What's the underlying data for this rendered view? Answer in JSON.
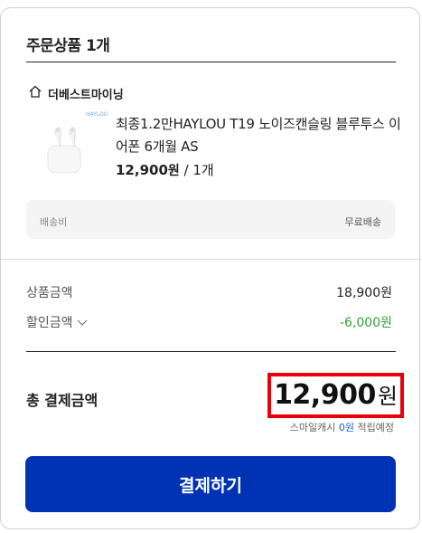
{
  "order": {
    "section_title": "주문상품 1개",
    "seller": {
      "name": "더베스트마이닝",
      "icon": "home-icon"
    },
    "product": {
      "name": "최종1.2만HAYLOU T19 노이즈캔슬링 블루투스 이어폰 6개월 AS",
      "price": "12,900",
      "price_unit": "원",
      "quantity": " / 1개",
      "thumbnail_tag": "HAYLOU",
      "thumbnail": "earbuds-product-image"
    },
    "shipping": {
      "label": "배송비",
      "value": "무료배송"
    }
  },
  "summary": {
    "goods_label": "상품금액",
    "goods_value": "18,900원",
    "discount_label": "할인금액",
    "discount_value": "-6,000원",
    "discount_icon": "chevron-down-icon",
    "total_label": "총 결제금액",
    "total_amount": "12,900",
    "total_unit": "원",
    "reward_prefix": "스마일캐시 ",
    "reward_amount": "0원",
    "reward_suffix": " 적립예정"
  },
  "checkout": {
    "button_label": "결제하기"
  },
  "colors": {
    "primary_button": "#0033b3",
    "discount_green": "#2fa33a",
    "highlight_red": "#e8000a",
    "reward_blue": "#1a5fd0"
  }
}
